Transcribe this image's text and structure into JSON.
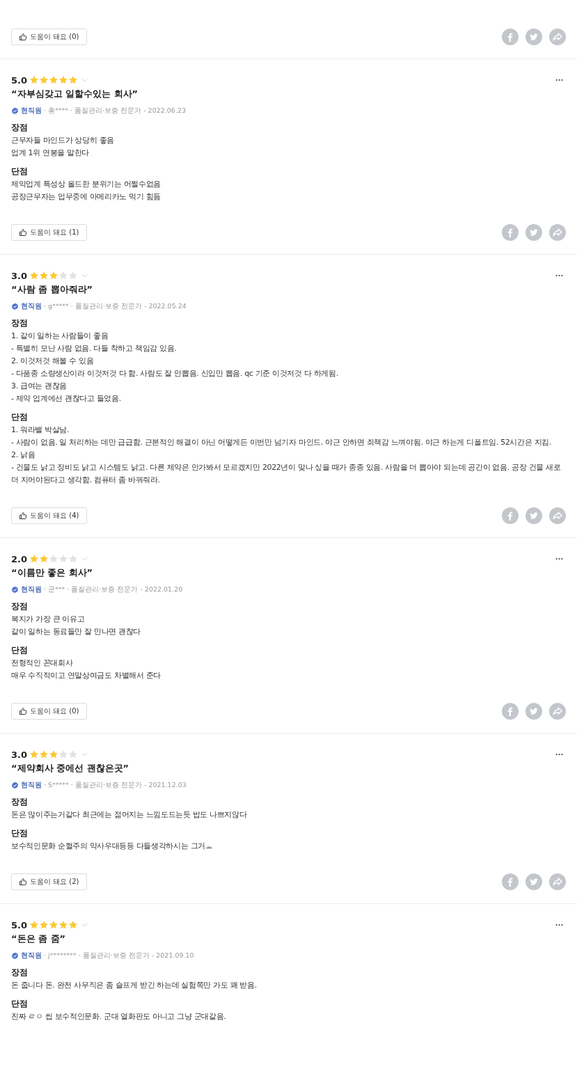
{
  "top_footer": {
    "helpful": "도움이 돼요 (0)"
  },
  "reviews": [
    {
      "rating": "5.0",
      "stars": 5,
      "title": "“자부심갖고 일할수있는 회사”",
      "status": "현직원",
      "meta": "· 총**** · 품질관리·보증 전문가 - 2022.06.23",
      "pros_label": "장점",
      "pros": [
        "근무자들 마인드가 상당히 좋음",
        "업계 1위 연봉을 말한다"
      ],
      "cons_label": "단점",
      "cons": [
        "제약업계 특성상 올드한 분위기는 어쩔수없음",
        "공장근무자는 업무중에 아메리카노 먹기 힘듬"
      ],
      "helpful": "도움이 돼요 (1)"
    },
    {
      "rating": "3.0",
      "stars": 3,
      "title": "“사람 좀 뽑아줘라”",
      "status": "현직원",
      "meta": "· g***** · 품질관리·보증 전문가 - 2022.05.24",
      "pros_label": "장점",
      "pros": [
        "1. 같이 일하는 사람들이 좋음",
        "- 특별히 모난 사람 없음. 다들 착하고 책임감 있음.",
        "2. 이것저것 해볼 수 있음",
        "- 다품종 소량생산이라 이것저것 다 함. 사람도 잘 안뽑음. 신입만 뽑음. qc 기준 이것저것 다 하게됨.",
        "3. 급여는 괜찮음",
        "- 제약 업계에선 괜찮다고 들었음."
      ],
      "cons_label": "단점",
      "cons": [
        "1. 워라밸 박살남.",
        "- 사람이 없음. 일 처리하는 데만 급급함. 근본적인 해결이 아닌 어떻게든 이번만 넘기자 마인드. 야근 안하면 죄책감 느껴야됨. 야근 하는게 디폴트임. 52시간은 지킴.",
        "2. 낡음",
        "- 건물도 낡고 장비도 낡고 시스템도 낡고. 다른 제약은 안가봐서 모르겠지만 2022년이 맞나 싶을 때가 종종 있음. 사람을 더 뽑아야 되는데 공간이 없음. 공장 건물 새로 더 지어야된다고 생각함. 컴퓨터 좀 바꿔줘라."
      ],
      "helpful": "도움이 돼요 (4)"
    },
    {
      "rating": "2.0",
      "stars": 2,
      "title": "“이름만 좋은 회사”",
      "status": "현직원",
      "meta": "· 군*** · 품질관리·보증 전문가 - 2022.01.20",
      "pros_label": "장점",
      "pros": [
        "복지가 가장 큰 이유고",
        "같이 일하는 동료들만 잘 만나면 괜찮다"
      ],
      "cons_label": "단점",
      "cons": [
        "전형적인 꼰대회사",
        "매우 수직적이고 연말상여금도 차별해서 준다"
      ],
      "helpful": "도움이 돼요 (0)"
    },
    {
      "rating": "3.0",
      "stars": 3,
      "title": "“제약회사 중에선 괜찮은곳”",
      "status": "현직원",
      "meta": "· S***** · 품질관리·보증 전문가 - 2021.12.03",
      "pros_label": "장점",
      "pros": [
        "돈은 많이주는거같다 최근에는 젊어지는 느낌도드는듯 밥도 나쁘지않다"
      ],
      "cons_label": "단점",
      "cons": [
        "보수적인문화 순혈주의 약사우대등등 다들생각하시는 그거ㅛ"
      ],
      "helpful": "도움이 돼요 (2)"
    },
    {
      "rating": "5.0",
      "stars": 5,
      "title": "“돈은 좀 줌”",
      "status": "현직원",
      "meta": "· j******** · 품질관리·보증 전문가 - 2021.09.10",
      "pros_label": "장점",
      "pros": [
        "돈 줍니다 돈. 완전 사무직은 좀 슬프게 받긴 하는데 실험쪽만 가도 꽤 받음."
      ],
      "cons_label": "단점",
      "cons": [
        "진짜 ㄹㅇ 씹 보수적인문화. 군대 열화판도 아니고 그냥 군대같음."
      ]
    }
  ]
}
